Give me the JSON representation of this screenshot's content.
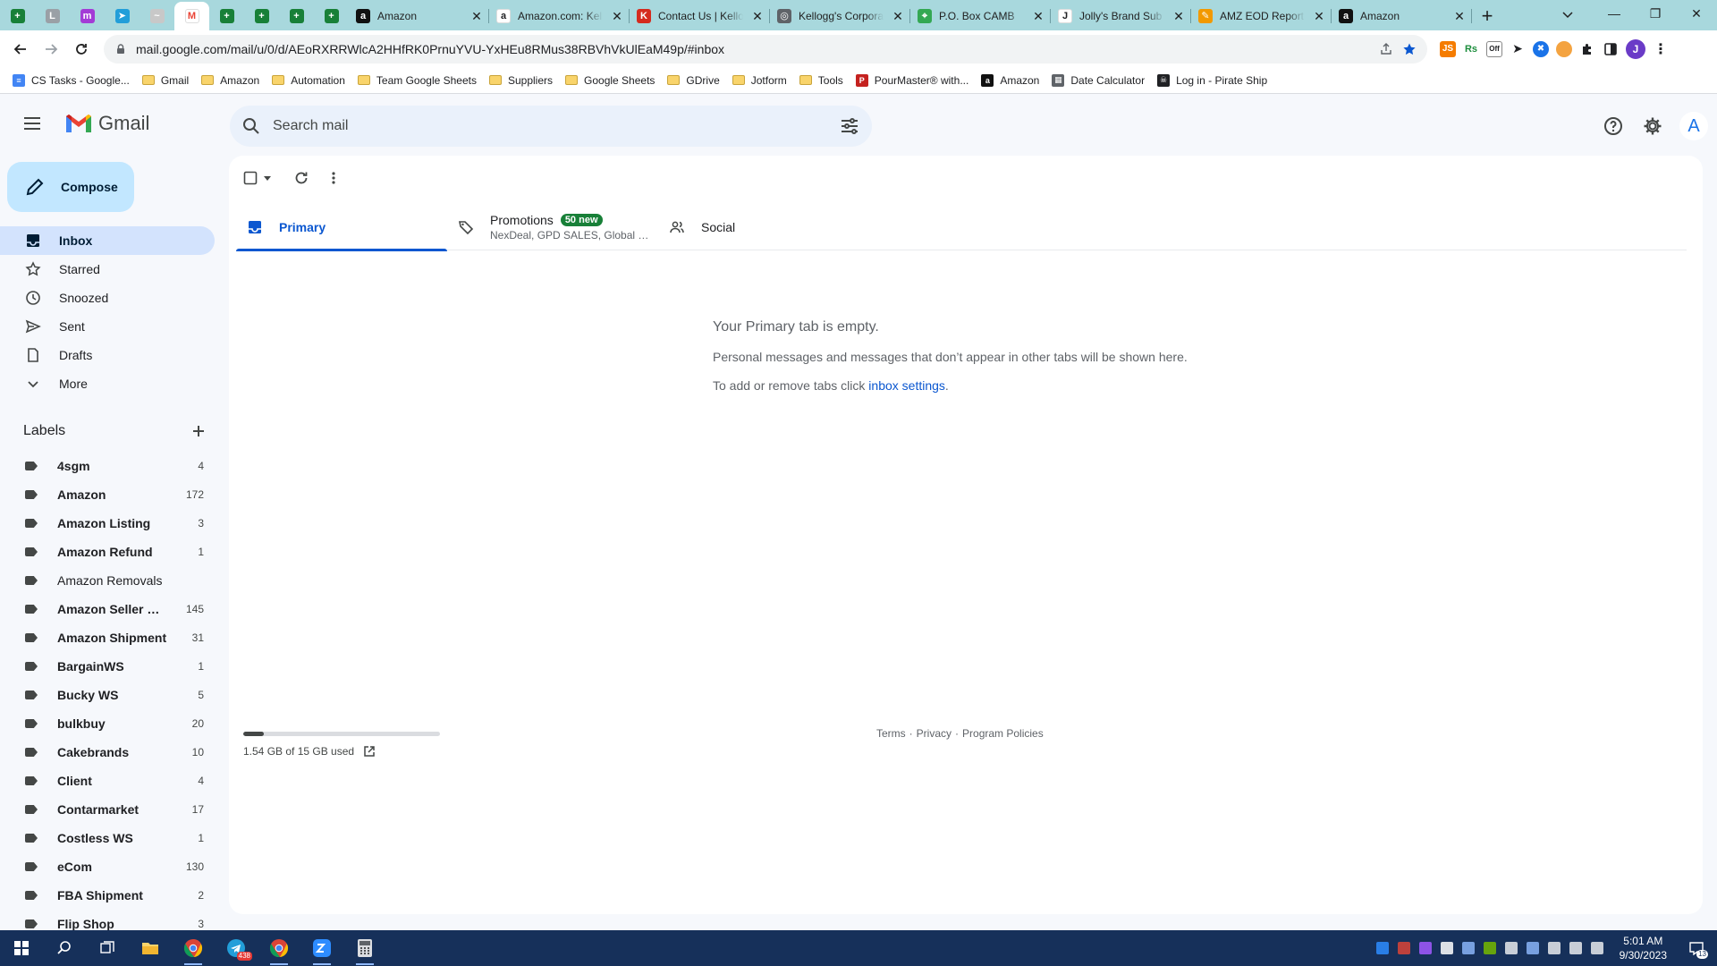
{
  "browser": {
    "tabs": [
      {
        "type": "pinned",
        "icon": "sheets",
        "title": ""
      },
      {
        "type": "pinned",
        "icon": "lsp",
        "title": ""
      },
      {
        "type": "pinned",
        "icon": "messenger",
        "title": ""
      },
      {
        "type": "pinned",
        "icon": "telegram",
        "title": ""
      },
      {
        "type": "pinned",
        "icon": "signature",
        "title": ""
      },
      {
        "type": "pinned",
        "icon": "gmail",
        "title": "",
        "active": true
      },
      {
        "type": "pinned",
        "icon": "sheets",
        "title": ""
      },
      {
        "type": "pinned",
        "icon": "sheets",
        "title": ""
      },
      {
        "type": "pinned",
        "icon": "sheets",
        "title": ""
      },
      {
        "type": "pinned",
        "icon": "sheets",
        "title": ""
      },
      {
        "type": "wide",
        "icon": "amazon",
        "title": "Amazon"
      },
      {
        "type": "wide",
        "icon": "amazon-a",
        "title": "Amazon.com: Kellogg"
      },
      {
        "type": "wide",
        "icon": "kelloggs",
        "title": "Contact Us | Kellogg"
      },
      {
        "type": "wide",
        "icon": "globe",
        "title": "Kellogg's Corporate"
      },
      {
        "type": "wide",
        "icon": "maps",
        "title": "P.O. Box CAMB"
      },
      {
        "type": "wide",
        "icon": "jollys",
        "title": "Jolly's Brand Sub"
      },
      {
        "type": "wide",
        "icon": "report",
        "title": "AMZ EOD Report"
      },
      {
        "type": "wide",
        "icon": "amazon",
        "title": "Amazon"
      }
    ],
    "url": "mail.google.com/mail/u/0/d/AEoRXRRWlcA2HHfRK0PrnuYVU-YxHEu8RMus38RBVhVkUlEaM49p/#inbox",
    "bookmarks": [
      {
        "icon": "docs",
        "label": "CS Tasks - Google..."
      },
      {
        "icon": "folder",
        "label": "Gmail"
      },
      {
        "icon": "folder",
        "label": "Amazon"
      },
      {
        "icon": "folder",
        "label": "Automation"
      },
      {
        "icon": "folder",
        "label": "Team Google Sheets"
      },
      {
        "icon": "folder",
        "label": "Suppliers"
      },
      {
        "icon": "folder",
        "label": "Google Sheets"
      },
      {
        "icon": "folder",
        "label": "GDrive"
      },
      {
        "icon": "folder",
        "label": "Jotform"
      },
      {
        "icon": "folder",
        "label": "Tools"
      },
      {
        "icon": "pourmaster",
        "label": "PourMaster® with..."
      },
      {
        "icon": "amazon",
        "label": "Amazon"
      },
      {
        "icon": "calculator",
        "label": "Date Calculator"
      },
      {
        "icon": "pirate",
        "label": "Log in - Pirate Ship"
      }
    ]
  },
  "gmail": {
    "logo_text": "Gmail",
    "search_placeholder": "Search mail",
    "avatar_letter": "A",
    "compose_label": "Compose",
    "nav": [
      {
        "id": "inbox",
        "label": "Inbox",
        "active": true
      },
      {
        "id": "starred",
        "label": "Starred"
      },
      {
        "id": "snoozed",
        "label": "Snoozed"
      },
      {
        "id": "sent",
        "label": "Sent"
      },
      {
        "id": "drafts",
        "label": "Drafts"
      },
      {
        "id": "more",
        "label": "More"
      }
    ],
    "labels_header": "Labels",
    "labels": [
      {
        "name": "4sgm",
        "count": "4",
        "bold": true
      },
      {
        "name": "Amazon",
        "count": "172",
        "bold": true
      },
      {
        "name": "Amazon Listing",
        "count": "3",
        "bold": true
      },
      {
        "name": "Amazon Refund",
        "count": "1",
        "bold": true
      },
      {
        "name": "Amazon Removals",
        "count": "",
        "bold": false
      },
      {
        "name": "Amazon Seller Ce...",
        "count": "145",
        "bold": true
      },
      {
        "name": "Amazon Shipment",
        "count": "31",
        "bold": true
      },
      {
        "name": "BargainWS",
        "count": "1",
        "bold": true
      },
      {
        "name": "Bucky WS",
        "count": "5",
        "bold": true
      },
      {
        "name": "bulkbuy",
        "count": "20",
        "bold": true
      },
      {
        "name": "Cakebrands",
        "count": "10",
        "bold": true
      },
      {
        "name": "Client",
        "count": "4",
        "bold": true
      },
      {
        "name": "Contarmarket",
        "count": "17",
        "bold": true
      },
      {
        "name": "Costless WS",
        "count": "1",
        "bold": true
      },
      {
        "name": "eCom",
        "count": "130",
        "bold": true
      },
      {
        "name": "FBA Shipment",
        "count": "2",
        "bold": true
      },
      {
        "name": "Flip Shop",
        "count": "3",
        "bold": true
      }
    ],
    "inbox_tabs": [
      {
        "id": "primary",
        "label": "Primary",
        "active": true,
        "badge": "",
        "subtitle": ""
      },
      {
        "id": "promotions",
        "label": "Promotions",
        "active": false,
        "badge": "50 new",
        "subtitle": "NexDeal, GPD SALES, Global Pri..."
      },
      {
        "id": "social",
        "label": "Social",
        "active": false,
        "badge": "",
        "subtitle": ""
      }
    ],
    "empty_state": {
      "title": "Your Primary tab is empty.",
      "line1": "Personal messages and messages that don’t appear in other tabs will be shown here.",
      "line2_prefix": "To add or remove tabs click ",
      "line2_link": "inbox settings",
      "line2_suffix": "."
    },
    "storage": {
      "text": "1.54 GB of 15 GB used",
      "used_fraction": 0.103
    },
    "footer": {
      "terms": "Terms",
      "privacy": "Privacy",
      "policies": "Program Policies",
      "separator": "·"
    }
  },
  "taskbar": {
    "apps": [
      {
        "icon": "windows-start"
      },
      {
        "icon": "search"
      },
      {
        "icon": "task-view"
      },
      {
        "icon": "file-explorer"
      },
      {
        "icon": "chrome-profile",
        "running": true
      },
      {
        "icon": "telegram",
        "badge": "438"
      },
      {
        "icon": "chrome",
        "running": true
      },
      {
        "icon": "zoom",
        "running": true
      },
      {
        "icon": "calculator",
        "running": true
      }
    ],
    "time": "5:01 AM",
    "date": "9/30/2023",
    "notification_count": "13"
  }
}
